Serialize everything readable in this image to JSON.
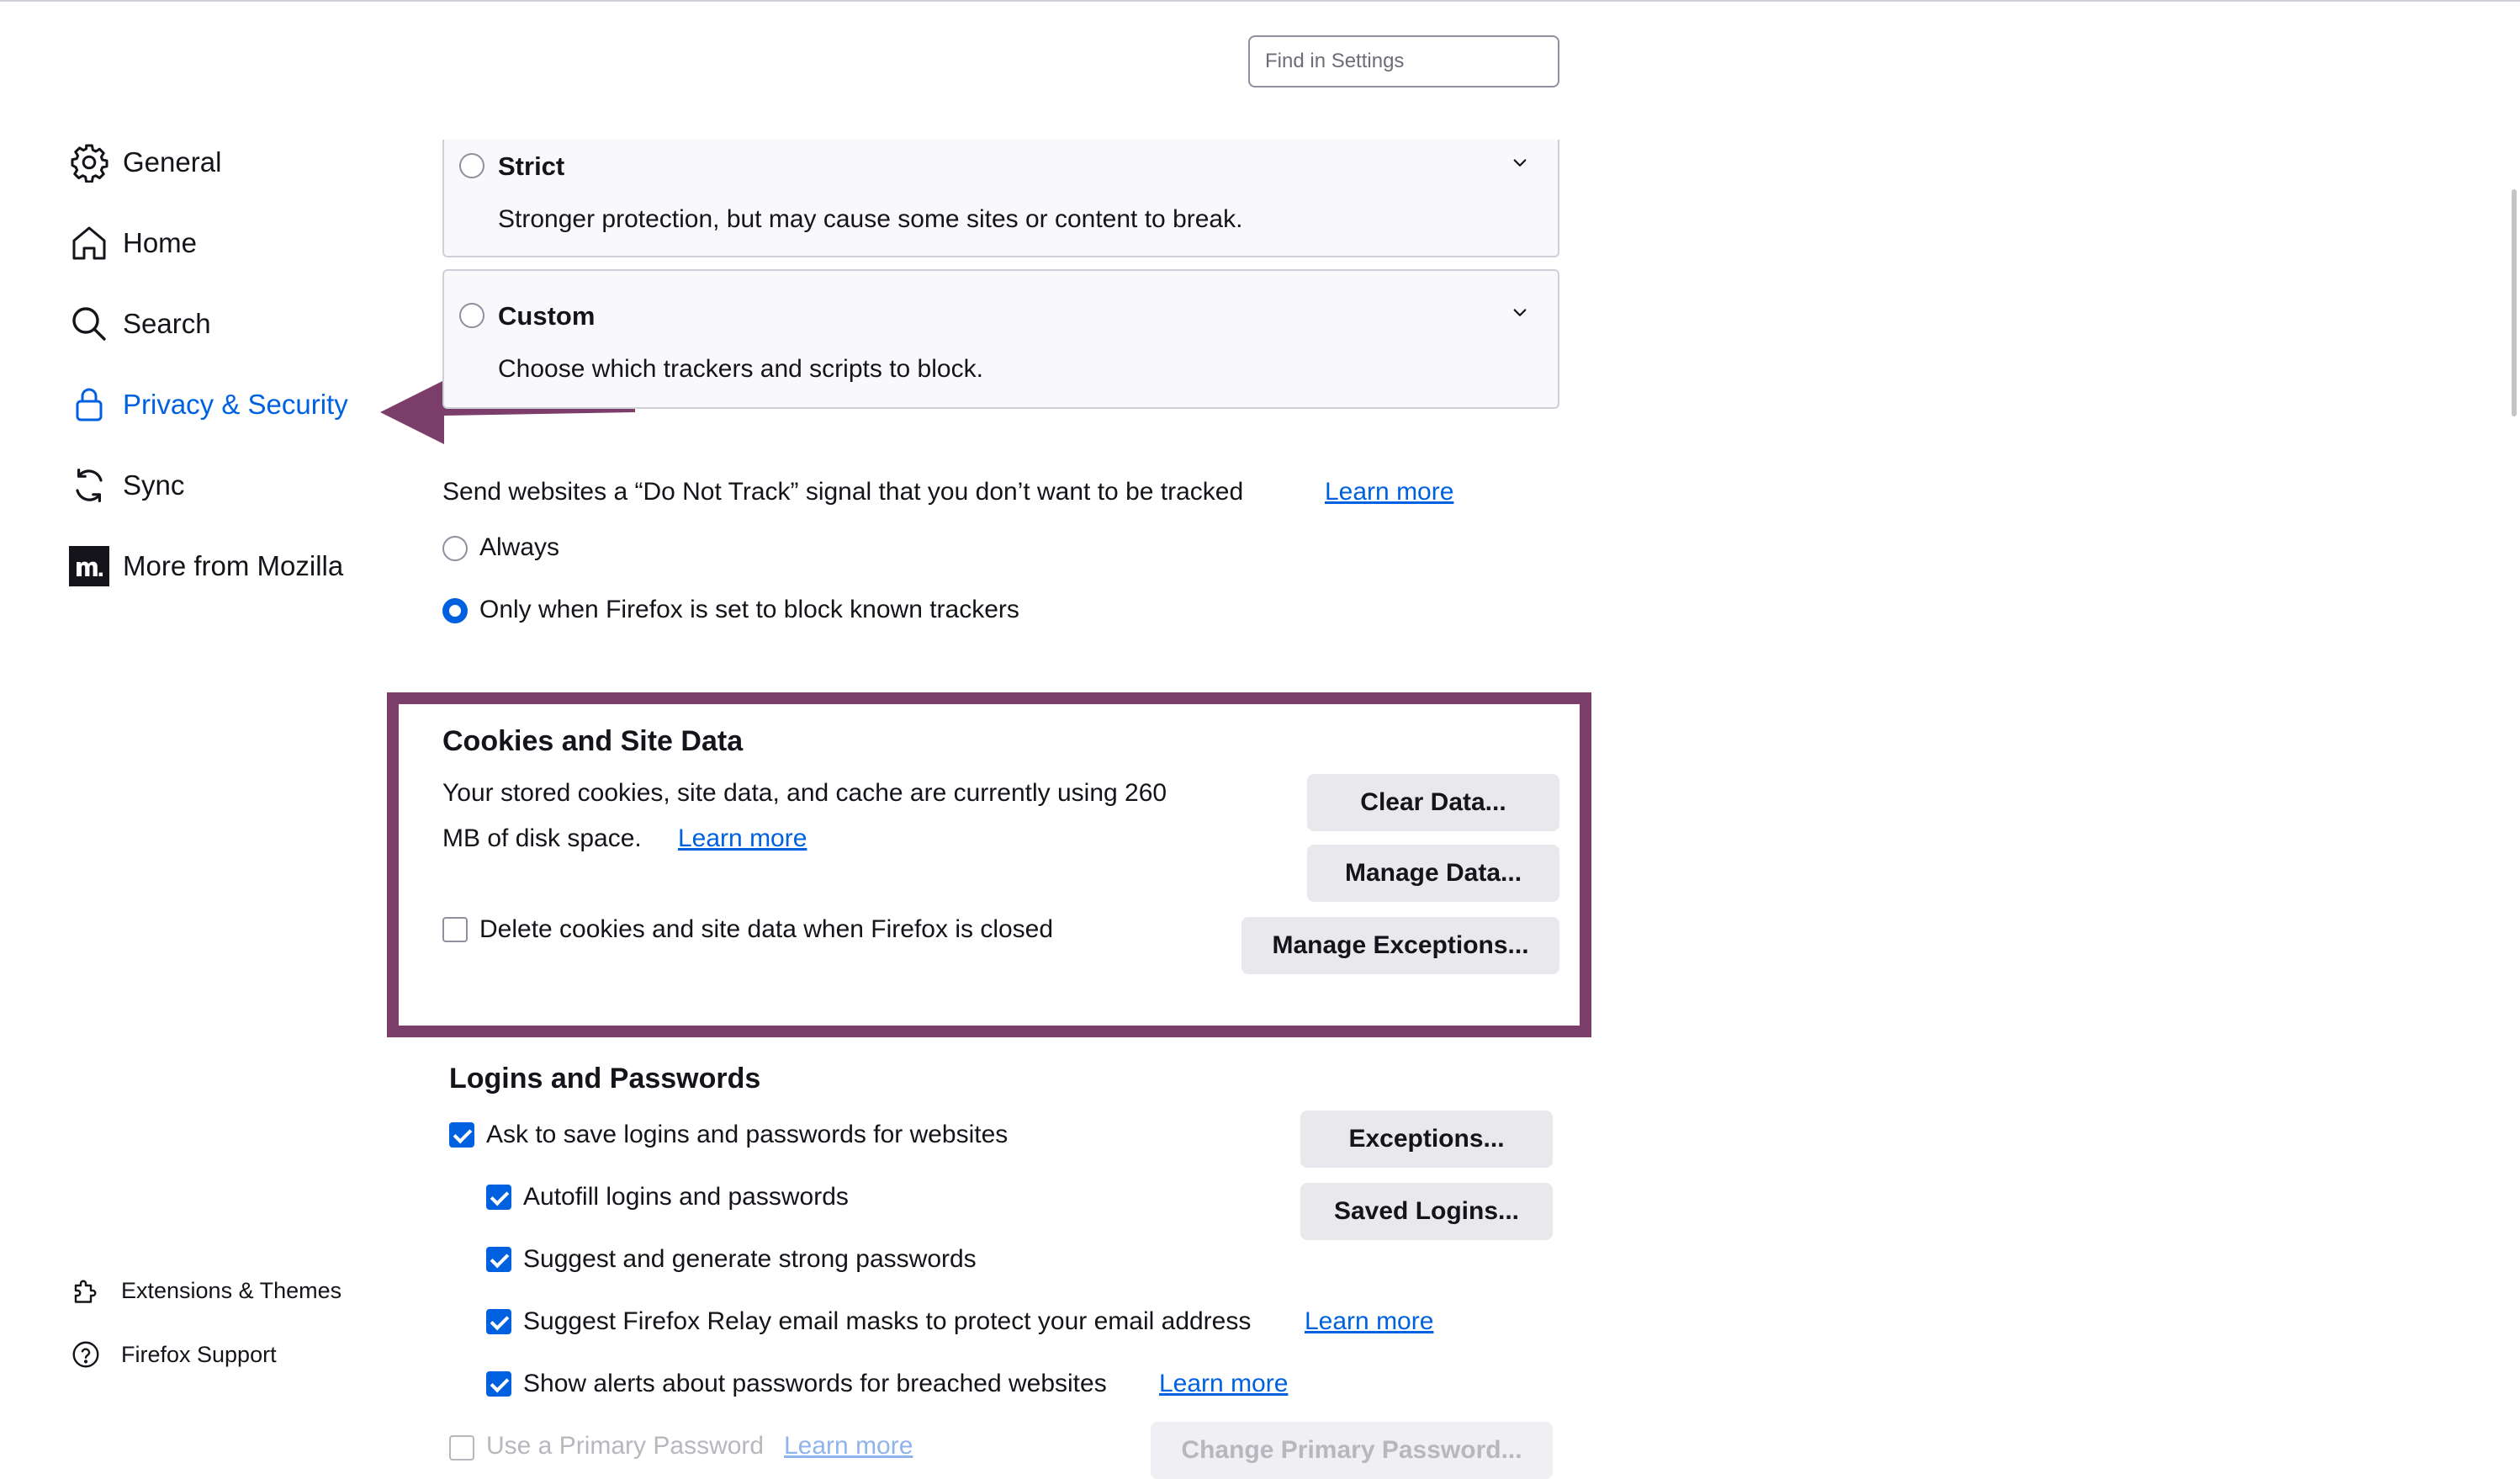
{
  "search": {
    "placeholder": "Find in Settings"
  },
  "sidebar": {
    "items": [
      {
        "label": "General",
        "icon": "gear-icon"
      },
      {
        "label": "Home",
        "icon": "home-icon"
      },
      {
        "label": "Search",
        "icon": "search-icon"
      },
      {
        "label": "Privacy & Security",
        "icon": "lock-icon",
        "active": true
      },
      {
        "label": "Sync",
        "icon": "sync-icon"
      },
      {
        "label": "More from Mozilla",
        "icon": "mozilla-icon"
      }
    ],
    "footer": [
      {
        "label": "Extensions & Themes",
        "icon": "puzzle-icon"
      },
      {
        "label": "Firefox Support",
        "icon": "help-icon"
      }
    ]
  },
  "tracking": {
    "strict": {
      "title": "Strict",
      "description": "Stronger protection, but may cause some sites or content to break."
    },
    "custom": {
      "title": "Custom",
      "description": "Choose which trackers and scripts to block."
    }
  },
  "dnt": {
    "label": "Send websites a “Do Not Track” signal that you don’t want to be tracked",
    "learn_more": "Learn more",
    "options": [
      {
        "label": "Always",
        "selected": false
      },
      {
        "label": "Only when Firefox is set to block known trackers",
        "selected": true
      }
    ]
  },
  "cookies": {
    "title": "Cookies and Site Data",
    "usage_line1": "Your stored cookies, site data, and cache are currently using 260",
    "usage_line2": "MB of disk space.",
    "learn_more": "Learn more",
    "delete_on_close": "Delete cookies and site data when Firefox is closed",
    "delete_on_close_checked": false,
    "buttons": {
      "clear": "Clear Data...",
      "manage": "Manage Data...",
      "exceptions": "Manage Exceptions..."
    }
  },
  "logins": {
    "title": "Logins and Passwords",
    "ask_to_save": "Ask to save logins and passwords for websites",
    "autofill": "Autofill logins and passwords",
    "suggest_strong": "Suggest and generate strong passwords",
    "relay": "Suggest Firefox Relay email masks to protect your email address",
    "relay_learn_more": "Learn more",
    "breach_alerts": "Show alerts about passwords for breached websites",
    "breach_learn_more": "Learn more",
    "primary_password": "Use a Primary Password",
    "primary_learn_more": "Learn more",
    "buttons": {
      "exceptions": "Exceptions...",
      "saved": "Saved Logins...",
      "change_primary": "Change Primary Password..."
    }
  },
  "colors": {
    "accent": "#0061e0",
    "highlight": "#7b3d69"
  }
}
